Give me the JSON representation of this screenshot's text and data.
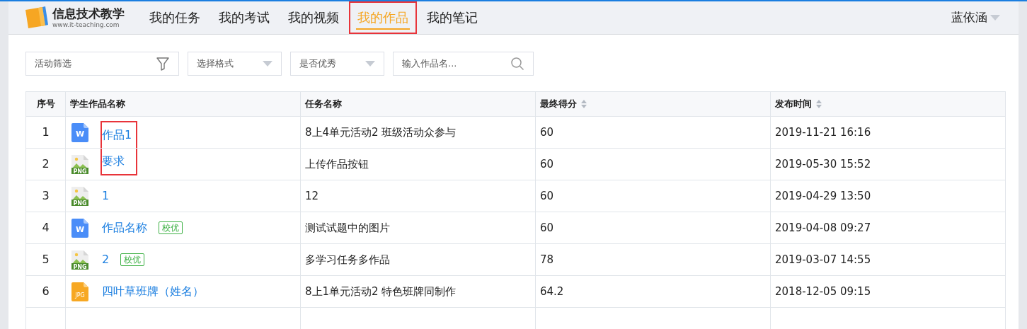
{
  "logo": {
    "title": "信息技术教学",
    "subtitle": "www.it-teaching.com"
  },
  "nav": [
    {
      "label": "我的任务",
      "selected": false,
      "highlighted": false
    },
    {
      "label": "我的考试",
      "selected": false,
      "highlighted": false
    },
    {
      "label": "我的视频",
      "selected": false,
      "highlighted": false
    },
    {
      "label": "我的作品",
      "selected": true,
      "highlighted": true
    },
    {
      "label": "我的笔记",
      "selected": false,
      "highlighted": false
    }
  ],
  "user": {
    "name": "蓝依涵"
  },
  "filters": [
    {
      "kind": "filter",
      "placeholder": "活动筛选"
    },
    {
      "kind": "select",
      "placeholder": "选择格式"
    },
    {
      "kind": "select",
      "placeholder": "是否优秀"
    },
    {
      "kind": "search",
      "placeholder": "输入作品名..."
    }
  ],
  "table": {
    "columns": [
      {
        "label": "序号",
        "sortable": false
      },
      {
        "label": "学生作品名称",
        "sortable": false
      },
      {
        "label": "任务名称",
        "sortable": false
      },
      {
        "label": "最终得分",
        "sortable": true
      },
      {
        "label": "发布时间",
        "sortable": true
      }
    ],
    "rows": [
      {
        "index": "1",
        "kind": "word",
        "file_label": "W",
        "name": "作品1",
        "task": "8上4单元活动2 班级活动众参与",
        "score": "60",
        "time": "2019-11-21 16:16",
        "highlighted": true
      },
      {
        "index": "2",
        "kind": "image",
        "file_label": "PNG",
        "name": "要求",
        "task": "上传作品按钮",
        "score": "60",
        "time": "2019-05-30 15:52",
        "highlighted": true
      },
      {
        "index": "3",
        "kind": "image",
        "file_label": "PNG",
        "name": "1",
        "task": "12",
        "score": "60",
        "time": "2019-04-29 13:50",
        "highlighted": false
      },
      {
        "index": "4",
        "kind": "word",
        "file_label": "W",
        "name": "作品名称",
        "badge": "校优",
        "task": "测试试题中的图片",
        "score": "60",
        "time": "2019-04-08 09:27",
        "highlighted": false
      },
      {
        "index": "5",
        "kind": "image",
        "file_label": "PNG",
        "name": "2",
        "badge": "校优",
        "task": "多学习任务多作品",
        "score": "78",
        "time": "2019-03-07 14:55",
        "highlighted": false
      },
      {
        "index": "6",
        "kind": "photo",
        "file_label": "JPG",
        "name": "四叶草班牌（姓名）",
        "task": "8上1单元活动2 特色班牌同制作",
        "score": "64.2",
        "time": "2018-12-05 09:15",
        "highlighted": false
      }
    ]
  }
}
